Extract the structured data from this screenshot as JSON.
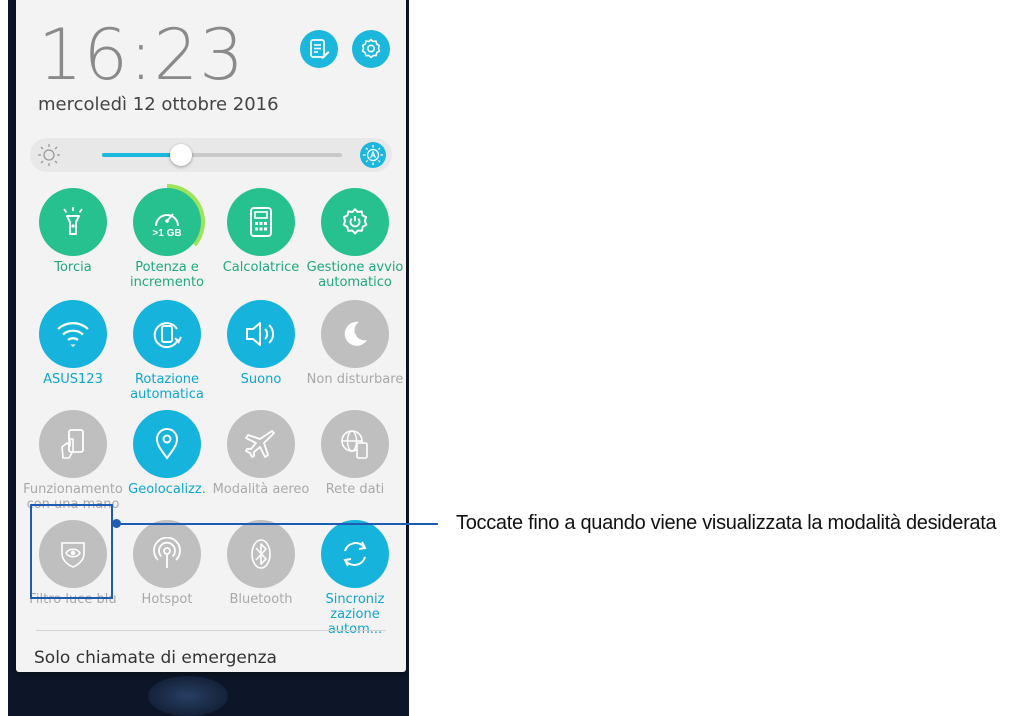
{
  "status": {
    "time": "16:23",
    "date": "mercoledì 12 ottobre 2016"
  },
  "header_icons": {
    "notes": "edit-note-icon",
    "settings": "gear-icon"
  },
  "brightness": {
    "level": 0.33,
    "manual_icon": "sun-icon",
    "auto_icon": "auto-brightness-icon",
    "auto_enabled": true
  },
  "tiles": [
    {
      "label": "Torcia",
      "icon": "flashlight-icon",
      "state": "on-green"
    },
    {
      "label": "Potenza e incremento",
      "icon": "speedometer-icon",
      "state": "on-green",
      "badge": ">1 GB"
    },
    {
      "label": "Calcolatrice",
      "icon": "calculator-icon",
      "state": "on-green"
    },
    {
      "label": "Gestione avvio automatico",
      "icon": "gear-power-icon",
      "state": "on-green"
    },
    {
      "label": "ASUS123",
      "icon": "wifi-icon",
      "state": "on-blue"
    },
    {
      "label": "Rotazione automatica",
      "icon": "auto-rotate-icon",
      "state": "on-blue"
    },
    {
      "label": "Suono",
      "icon": "speaker-icon",
      "state": "on-blue"
    },
    {
      "label": "Non disturbare",
      "icon": "moon-icon",
      "state": "off"
    },
    {
      "label": "Funzionamento con una mano",
      "icon": "one-hand-icon",
      "state": "off"
    },
    {
      "label": "Geolocalizz.",
      "icon": "location-pin-icon",
      "state": "on-blue"
    },
    {
      "label": "Modalità aereo",
      "icon": "airplane-icon",
      "state": "off"
    },
    {
      "label": "Rete dati",
      "icon": "globe-phone-icon",
      "state": "off"
    },
    {
      "label": "Filtro luce blu",
      "icon": "eye-shield-icon",
      "state": "off"
    },
    {
      "label": "Hotspot",
      "icon": "hotspot-icon",
      "state": "off"
    },
    {
      "label": "Bluetooth",
      "icon": "bluetooth-icon",
      "state": "off"
    },
    {
      "label": "Sincroniz zazione autom...",
      "icon": "sync-icon",
      "state": "on-blue"
    }
  ],
  "footer": {
    "emergency": "Solo chiamate di emergenza"
  },
  "callout": {
    "text": "Toccate fino a quando viene visualizzata la modalità desiderata"
  },
  "colors": {
    "accent_blue": "#16b4dc",
    "accent_green": "#27c08f",
    "off_gray": "#bfbfbf",
    "callout_blue": "#1e5cb3"
  }
}
